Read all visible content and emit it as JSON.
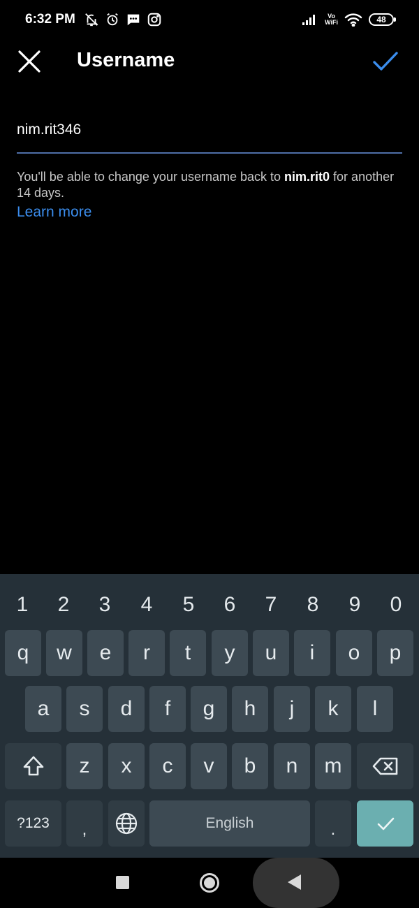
{
  "status_bar": {
    "time": "6:32 PM",
    "left_icons": [
      "bell-off-icon",
      "alarm-icon",
      "message-icon",
      "instagram-icon"
    ],
    "right_icons": [
      "signal-icon",
      "vowifi-icon",
      "wifi-icon",
      "battery-icon"
    ],
    "vowifi_top": "Vo",
    "vowifi_bottom": "WiFi",
    "battery_level": "48"
  },
  "header": {
    "title": "Username",
    "close_icon": "close-icon",
    "done_icon": "check-icon",
    "accent_color": "#3b8ded"
  },
  "form": {
    "username_value": "nim.rit346",
    "help_text_before": "You'll be able to change your username back to ",
    "help_text_previous": "nim.rit0",
    "help_text_after": " for another 14 days.",
    "learn_more": "Learn more"
  },
  "keyboard": {
    "number_row": [
      "1",
      "2",
      "3",
      "4",
      "5",
      "6",
      "7",
      "8",
      "9",
      "0"
    ],
    "row1": [
      "q",
      "w",
      "e",
      "r",
      "t",
      "y",
      "u",
      "i",
      "o",
      "p"
    ],
    "row2": [
      "a",
      "s",
      "d",
      "f",
      "g",
      "h",
      "j",
      "k",
      "l"
    ],
    "row3": [
      "z",
      "x",
      "c",
      "v",
      "b",
      "n",
      "m"
    ],
    "symbols_label": "?123",
    "comma_label": ",",
    "space_label": "English",
    "period_label": ".",
    "colors": {
      "background": "#253038",
      "key": "#3d4a53",
      "enter": "#6bafb0"
    }
  },
  "nav_bar": {
    "buttons": [
      "recents-button",
      "home-button",
      "back-button"
    ]
  }
}
